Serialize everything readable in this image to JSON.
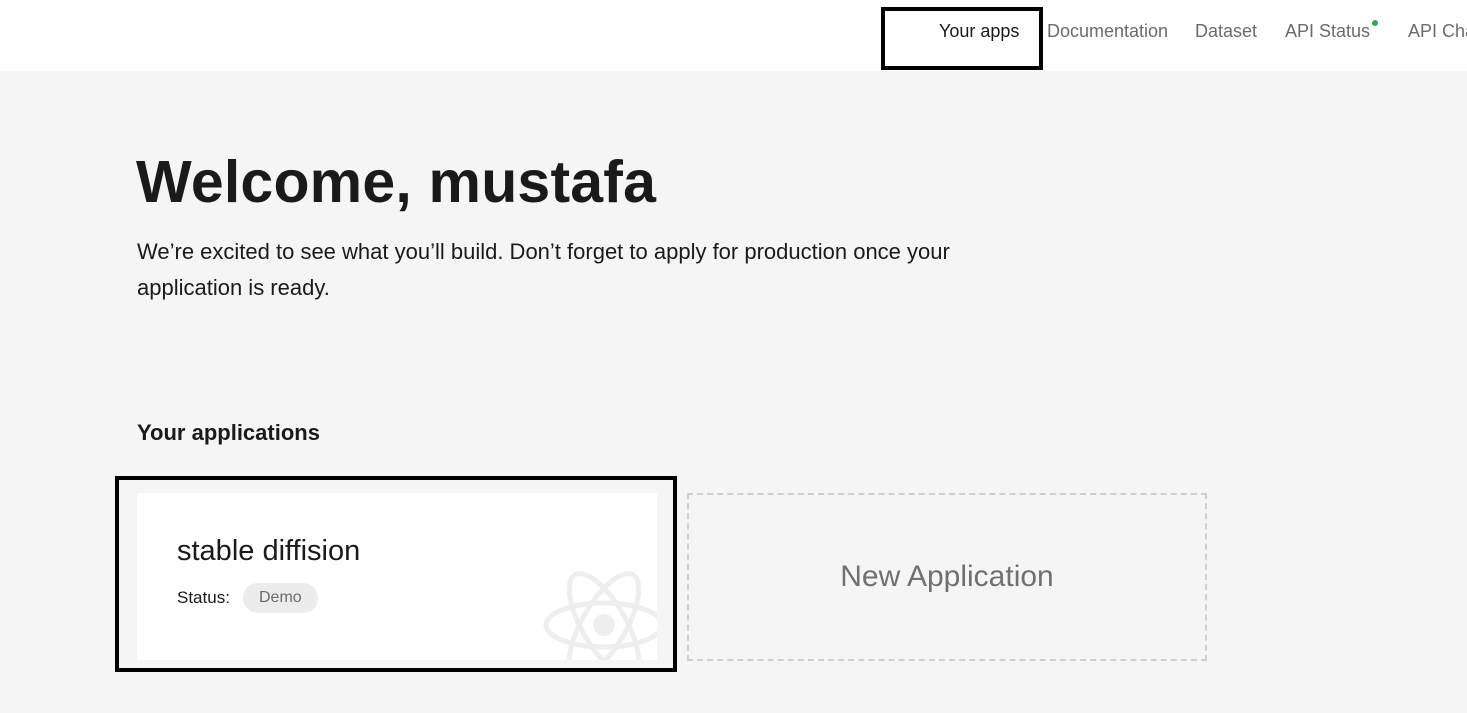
{
  "nav": {
    "your_apps": "Your apps",
    "documentation": "Documentation",
    "dataset": "Dataset",
    "api_status": "API Status",
    "api_changelog": "API Cha"
  },
  "hero": {
    "welcome": "Welcome, mustafa",
    "intro": "We’re excited to see what you’ll build. Don’t forget to apply for production once your application is ready."
  },
  "applications": {
    "title": "Your applications",
    "items": [
      {
        "name": "stable diffision",
        "status_label": "Status:",
        "status": "Demo",
        "icon": "atom-icon"
      }
    ],
    "new_label": "New Application"
  },
  "colors": {
    "status_dot": "#2bb24c",
    "page_bg": "#f5f5f5",
    "highlight": "#000000"
  }
}
